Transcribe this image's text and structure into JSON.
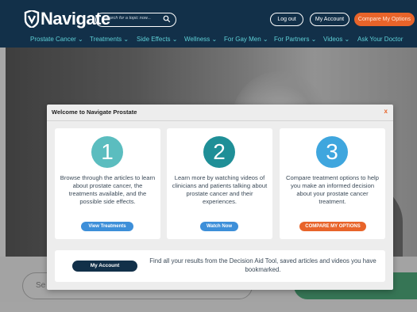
{
  "header": {
    "logo_text": "Navigate",
    "search_placeholder": "Search for a topic now...",
    "buttons": {
      "logout": "Log out",
      "account": "My Account",
      "compare": "Compare My Options"
    },
    "nav": [
      "Prostate Cancer ⌄",
      "Treatments ⌄",
      "Side Effects ⌄",
      "Wellness ⌄",
      "For Gay Men ⌄",
      "For Partners ⌄",
      "Videos ⌄",
      "Ask Your Doctor"
    ]
  },
  "background": {
    "search_placeholder": "Se"
  },
  "modal": {
    "title": "Welcome to Navigate Prostate",
    "close": "x",
    "cards": [
      {
        "step": "1",
        "color": "#5bbdbf",
        "text": "Browse through the articles to learn about prostate cancer, the treatments available, and the possible side effects.",
        "button": "View Treatments",
        "button_color": "#3d8fd9"
      },
      {
        "step": "2",
        "color": "#1f8f97",
        "text": "Learn more by watching videos of clinicians and patients talking about prostate cancer and their experiences.",
        "button": "Watch Now",
        "button_color": "#3d8fd9"
      },
      {
        "step": "3",
        "color": "#3fa6de",
        "text": "Compare treatment options to help you make an informed decision about your prostate cancer treatment.",
        "button": "COMPARE MY OPTIONS",
        "button_color": "#e8642a"
      }
    ],
    "bottom": {
      "button": "My Account",
      "text": "Find all your results from the Decision Aid Tool, saved articles and videos you have bookmarked."
    }
  }
}
